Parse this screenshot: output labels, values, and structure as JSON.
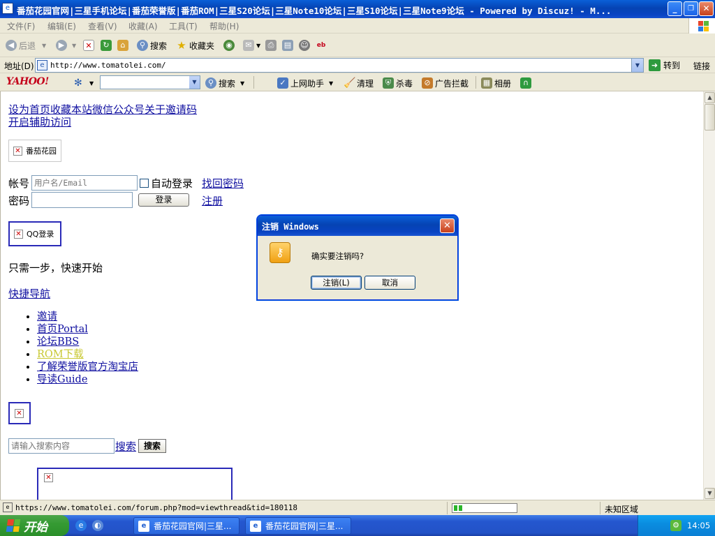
{
  "window": {
    "title": "番茄花园官网|三星手机论坛|番茄荣誉版|番茄ROM|三星S20论坛|三星Note10论坛|三星S10论坛|三星Note9论坛 - Powered by Discuz! - M...",
    "controls": {
      "minimize": "_",
      "maximize": "❐",
      "close": "✕"
    }
  },
  "menubar": {
    "items": [
      "文件(F)",
      "编辑(E)",
      "查看(V)",
      "收藏(A)",
      "工具(T)",
      "帮助(H)"
    ]
  },
  "toolbar": {
    "back": "后退",
    "search": "搜索",
    "favorites": "收藏夹"
  },
  "addressbar": {
    "label": "地址(D)",
    "url": "http://www.tomatolei.com/",
    "go": "转到",
    "links": "链接"
  },
  "yahoobar": {
    "logo": "YAHOO!",
    "search": "搜索",
    "assistant": "上网助手",
    "clean": "清理",
    "antivirus": "杀毒",
    "adblock": "广告拦截",
    "album": "相册"
  },
  "page": {
    "top_links": "设为首页收藏本站微信公众号关于邀请码",
    "accessibility": "开启辅助访问",
    "logo_alt": "番茄花园",
    "login": {
      "account_label": "帐号",
      "account_placeholder": "用户名/Email",
      "autologin": "自动登录",
      "forgot": "找回密码",
      "password_label": "密码",
      "login_button": "登录",
      "register": "注册"
    },
    "qq_login_alt": "QQ登录",
    "one_step": "只需一步，快速开始",
    "quick_nav": "快捷导航",
    "nav_items": [
      "邀请",
      "首页Portal",
      "论坛BBS",
      "ROM下载",
      "了解荣誉版官方淘宝店",
      "导读Guide"
    ],
    "search_placeholder": "请输入搜索内容",
    "search_link": "搜索",
    "search_button": "搜索"
  },
  "statusbar": {
    "url": "https://www.tomatolei.com/forum.php?mod=viewthread&tid=180118",
    "zone": "未知区域",
    "progress": 0.14
  },
  "dialog": {
    "title": "注销 Windows",
    "message": "确实要注销吗?",
    "ok": "注销(L)",
    "cancel": "取消"
  },
  "taskbar": {
    "start": "开始",
    "tasks": [
      "番茄花园官网|三星...",
      "番茄花园官网|三星..."
    ],
    "clock": "14:05"
  },
  "colors": {
    "link": "#0f0fa0",
    "xp_blue": "#0543b3",
    "start_green": "#359b33"
  }
}
